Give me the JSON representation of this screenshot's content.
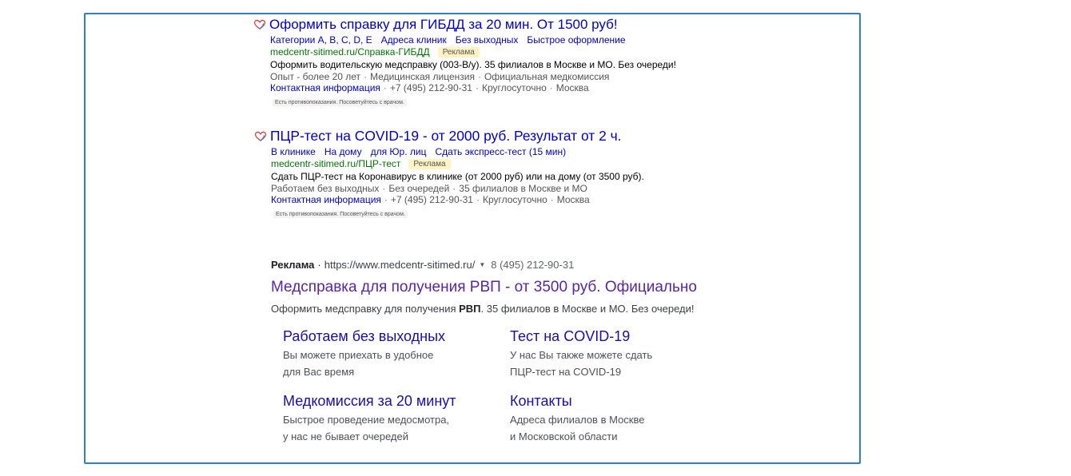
{
  "ad1": {
    "title": "Оформить справку для ГИБДД за 20 мин. От 1500 руб!",
    "sitelinks": [
      "Категории A, B, C, D, E",
      "Адреса клиник",
      "Без выходных",
      "Быстрое оформление"
    ],
    "url": "medcentr-sitimed.ru/Справка-ГИБДД",
    "badge": "Реклама",
    "description": "Оформить водительскую медсправку (003-В/у). 35 филиалов в Москве и МО. Без очереди!",
    "features": [
      "Опыт - более 20 лет",
      "Медицинская лицензия",
      "Официальная медкомиссия"
    ],
    "contact_label": "Контактная информация",
    "phone": "+7 (495) 212-90-31",
    "hours": "Круглосуточно",
    "city": "Москва",
    "warning": "Есть противопоказания. Посоветуйтесь с врачом."
  },
  "ad2": {
    "title": "ПЦР-тест на COVID-19 - от 2000 руб. Результат от 2 ч.",
    "sitelinks": [
      "В клинике",
      "На дому",
      "для Юр. лиц",
      "Сдать экспресс-тест (15 мин)"
    ],
    "url": "medcentr-sitimed.ru/ПЦР-тест",
    "badge": "Реклама",
    "description": "Сдать ПЦР-тест на Коронавирус в клинике (от 2000 руб) или на дому (от 3500 руб).",
    "features": [
      "Работаем без выходных",
      "Без очередей",
      "35 филиалов в Москве и МО"
    ],
    "contact_label": "Контактная информация",
    "phone": "+7 (495) 212-90-31",
    "hours": "Круглосуточно",
    "city": "Москва",
    "warning": "Есть противопоказания. Посоветуйтесь с врачом."
  },
  "google_ad": {
    "label": "Реклама",
    "dot": "·",
    "url": "https://www.medcentr-sitimed.ru/",
    "arrow": "▼",
    "phone": "8 (495) 212-90-31",
    "title": "Медсправка для получения РВП - от 3500 руб. Официально",
    "desc_before": "Оформить медсправку для получения ",
    "desc_bold": "РВП",
    "desc_after": ". 35 филиалов в Москве и МО. Без очереди!",
    "sitelinks": [
      {
        "title": "Работаем без выходных",
        "line1": "Вы можете приехать в удобное",
        "line2": "для Вас время"
      },
      {
        "title": "Тест на COVID-19",
        "line1": "У нас Вы также можете сдать",
        "line2": "ПЦР-тест на COVID-19"
      },
      {
        "title": "Медкомиссия за 20 минут",
        "line1": "Быстрое проведение медосмотра,",
        "line2": "у нас не бывает очередей"
      },
      {
        "title": "Контакты",
        "line1": "Адреса филиалов в Москве",
        "line2": "и Московской области"
      }
    ]
  },
  "colors": {
    "frame_border": "#2f7fc1",
    "yandex_link": "#0000cc",
    "url_green": "#007700",
    "google_visited": "#5925a5",
    "google_link": "#1a0dab",
    "badge_bg": "#fff3c4"
  }
}
